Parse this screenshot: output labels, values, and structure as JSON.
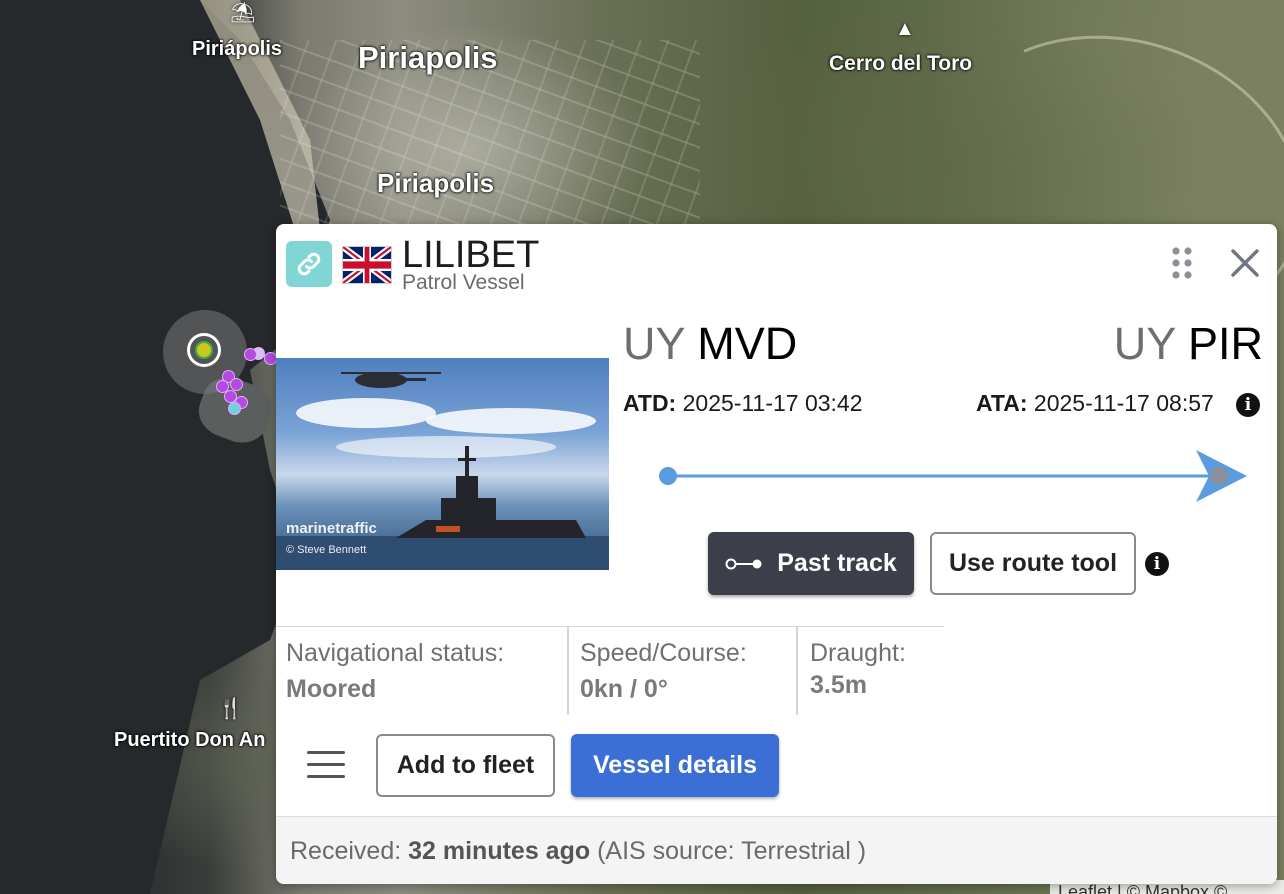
{
  "map": {
    "labels": {
      "piriapolis_small": "Piriápolis",
      "piriapolis_big": "Piriapolis",
      "piriapolis_mid": "Piriapolis",
      "cerro_del_toro": "Cerro del Toro",
      "puertito": "Puertito Don An"
    },
    "attribution": "Leaflet | © Mapbox ©"
  },
  "vessel": {
    "name": "LILIBET",
    "type": "Patrol Vessel",
    "flag": "united-kingdom-flag",
    "photo_watermark": "marinetraffic",
    "photo_credit": "© Steve Bennett"
  },
  "voyage": {
    "from_country": "UY",
    "from_port": "MVD",
    "to_country": "UY",
    "to_port": "PIR",
    "atd_label": "ATD:",
    "atd_value": "2025-11-17 03:42",
    "ata_label": "ATA:",
    "ata_value": "2025-11-17 08:57",
    "progress": 0.94,
    "route_color": "#5b9be0"
  },
  "buttons": {
    "past_track": "Past track",
    "route_tool": "Use route tool",
    "add_to_fleet": "Add to fleet",
    "vessel_details": "Vessel details"
  },
  "status": {
    "nav_label": "Navigational status:",
    "nav_value": "Moored",
    "speed_label": "Speed/Course:",
    "speed_value": "0kn / 0°",
    "draught_label": "Draught:",
    "draught_value": "3.5m"
  },
  "footer": {
    "received_prefix": "Received:",
    "received_value": "32 minutes ago",
    "source_text": "(AIS source: Terrestrial )"
  },
  "colors": {
    "accent_blue": "#3b6fd6",
    "link_teal": "#7fd6d5",
    "dark_button": "#3c3f49"
  }
}
